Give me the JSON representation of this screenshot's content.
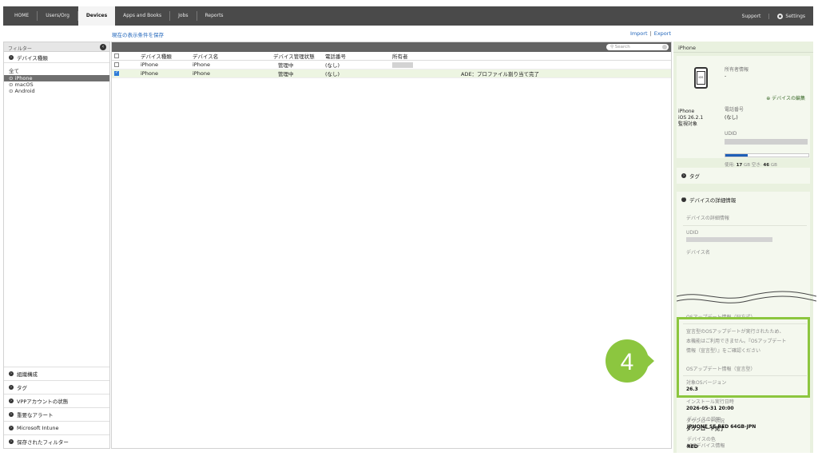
{
  "nav": {
    "items": [
      "HOME",
      "Users/Org",
      "Devices",
      "Apps and Books",
      "Jobs",
      "Reports"
    ],
    "active": "Devices",
    "support": "Support",
    "settings": "Settings"
  },
  "toolbar": {
    "save_view": "現在の表示条件を保存",
    "import": "Import",
    "export": "Export",
    "separator": "|"
  },
  "filter": {
    "header": "フィルター",
    "device_type_label": "デバイス種類",
    "items": [
      "全て",
      "iPhone",
      "macOS",
      "Android"
    ],
    "selected": "iPhone",
    "bottom_sections": [
      "組織構成",
      "タグ",
      "VPPアカウントの状態",
      "重要なアラート",
      "Microsoft Intune",
      "保存されたフィルター"
    ]
  },
  "table": {
    "search_placeholder": "Search",
    "columns": [
      "デバイス種類",
      "デバイス名",
      "デバイス管理状態",
      "電話番号",
      "所有者"
    ],
    "rows": [
      {
        "type": "iPhone",
        "name": "iPhone",
        "status": "管理中",
        "phone": "(なし)",
        "owner": "",
        "note": "",
        "checked": false,
        "selected": false
      },
      {
        "type": "iPhone",
        "name": "iPhone",
        "status": "管理中",
        "phone": "(なし)",
        "owner": "",
        "note": "ADE：プロファイル割り当て完了",
        "checked": true,
        "selected": true
      }
    ]
  },
  "detail": {
    "title": "iPhone",
    "device_label": "iPhone",
    "os_version": "iOS 26.2.1",
    "supervised": "監視対象",
    "owner_info_label": "所有者情報",
    "owner_info_value": "-",
    "edit_device": "デバイスの編集",
    "phone_label": "電話番号",
    "phone_value": "(なし)",
    "udid_label": "UDID",
    "storage_used_label": "使用:",
    "storage_used": "17",
    "storage_free_label": "空き:",
    "storage_free": "46",
    "storage_unit": "GB",
    "storage_fraction": 0.27,
    "tag_section": "タグ",
    "details_section": "デバイスの詳細情報",
    "sub_details": "デバイスの詳細情報",
    "udid_label2": "UDID",
    "device_name_label": "デバイス名",
    "os_update_old": "OSアップデート情報（旧方式）",
    "os_update_old_note": [
      "宣言型のOSアップデートが実行されたため、",
      "本機能はご利用できません。『OSアップデート",
      "情報（宣言型）』をご確認ください"
    ],
    "os_update_decl": "OSアップデート情報（宣言型）",
    "target_os_label": "対象OSバージョン",
    "target_os_value": "26.3",
    "install_date_label": "インストール実行日時",
    "install_date_value": "2026-05-31 20:00",
    "download_status_label": "ダウンロード状況",
    "download_status_value": "ダウンロード完了",
    "ade_info": "ADEデバイス情報",
    "description_label": "デバイスの説明",
    "description_value": "IPHONE SE RED 64GB-JPN",
    "color_label": "デバイスの色",
    "color_value": "RED"
  },
  "callout": {
    "number": "4",
    "color": "#8cc63f"
  }
}
